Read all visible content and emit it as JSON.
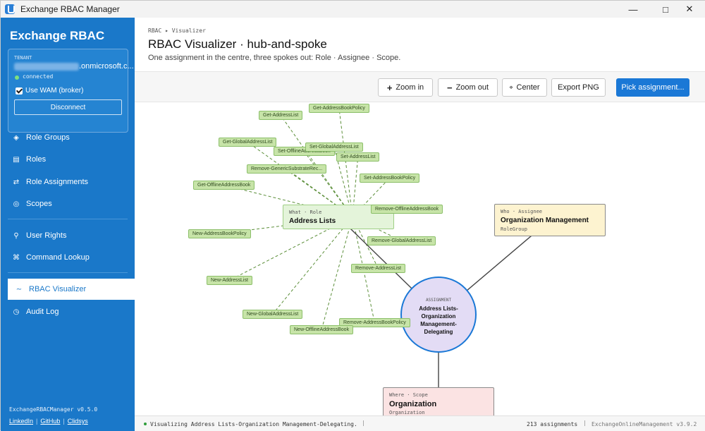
{
  "window": {
    "title": "Exchange RBAC Manager",
    "icon": "app-logo-icon"
  },
  "sidebar": {
    "brand": "Exchange RBAC",
    "tenant": {
      "label": "TENANT",
      "domain_suffix": ".onmicrosoft.c...",
      "status": "connected",
      "use_wam_label": "Use WAM (broker)",
      "use_wam_checked": true,
      "disconnect_label": "Disconnect"
    },
    "nav": [
      {
        "label": "Role Groups",
        "icon": "diamond-icon",
        "active": false
      },
      {
        "label": "Roles",
        "icon": "list-icon",
        "active": false
      },
      {
        "label": "Role Assignments",
        "icon": "swap-icon",
        "active": false
      },
      {
        "label": "Scopes",
        "icon": "target-icon",
        "active": false
      },
      {
        "label": "User Rights",
        "icon": "key-icon",
        "active": false
      },
      {
        "label": "Command Lookup",
        "icon": "command-icon",
        "active": false
      },
      {
        "label": "RBAC Visualizer",
        "icon": "wave-icon",
        "active": true
      },
      {
        "label": "Audit Log",
        "icon": "clock-icon",
        "active": false
      }
    ],
    "version": "ExchangeRBACManager v0.5.0",
    "links": [
      "LinkedIn",
      "GitHub",
      "Clidsys"
    ]
  },
  "header": {
    "breadcrumb": "RBAC ▸ Visualizer",
    "title": "RBAC Visualizer · hub-and-spoke",
    "subtitle": "One assignment in the centre, three spokes out: Role · Assignee · Scope."
  },
  "toolbar": {
    "zoom_in": "Zoom in",
    "zoom_out": "Zoom out",
    "center": "Center",
    "export": "Export PNG",
    "pick": "Pick assignment..."
  },
  "graph": {
    "hub": {
      "kicker": "ASSIGNMENT",
      "title": "Address Lists-Organization Management-Delegating"
    },
    "role": {
      "kicker": "What · Role",
      "title": "Address Lists"
    },
    "assignee": {
      "kicker": "Who · Assignee",
      "title": "Organization Management",
      "sub": "RoleGroup"
    },
    "scope": {
      "kicker": "Where · Scope",
      "title": "Organization",
      "sub": "Organization"
    },
    "cmdlets": [
      "Get-AddressBookPolicy",
      "Get-AddressList",
      "Get-GlobalAddressList",
      "Set-OfflineAddressBook",
      "Set-GlobalAddressList",
      "Set-AddressList",
      "Remove-GenericSubstrateRec...",
      "Set-AddressBookPolicy",
      "Get-OfflineAddressBook",
      "Remove-OfflineAddressBook",
      "New-AddressBookPolicy",
      "Remove-GlobalAddressList",
      "Remove-AddressList",
      "New-AddressList",
      "New-GlobalAddressList",
      "Remove-AddressBookPolicy",
      "New-OfflineAddressBook"
    ],
    "colors": {
      "chip_fill": "#c7e4a8",
      "role_fill": "#e4f4da",
      "assignee_fill": "#fdf3d0",
      "scope_fill": "#fbe3e3",
      "hub_fill": "#e3dcf5",
      "accent": "#1a78d6"
    }
  },
  "statusbar": {
    "message": "Visualizing Address Lists-Organization Management-Delegating.",
    "count": "213 assignments",
    "module": "ExchangeOnlineManagement v3.9.2"
  }
}
